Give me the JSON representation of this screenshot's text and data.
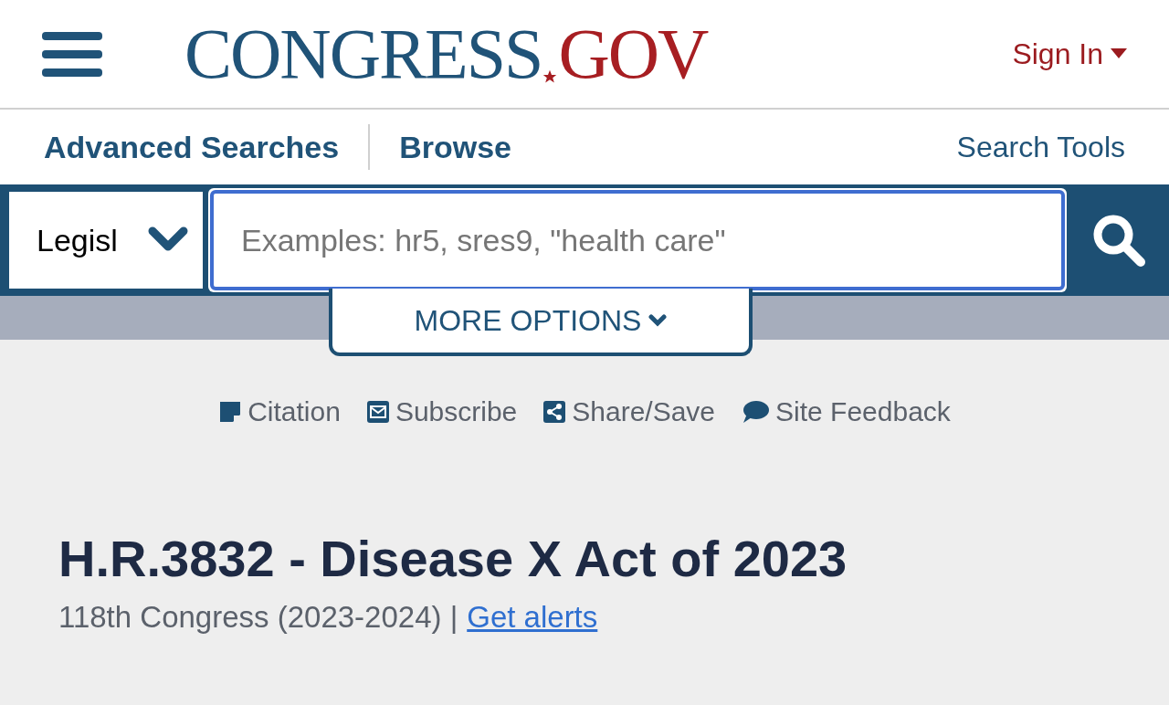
{
  "header": {
    "logo": {
      "first": "CONGRESS",
      "second": "GOV"
    },
    "sign_in": "Sign In"
  },
  "nav": {
    "items": [
      {
        "label": "Advanced Searches"
      },
      {
        "label": "Browse"
      }
    ],
    "tools": "Search Tools"
  },
  "search": {
    "scope": "Legisl",
    "placeholder": "Examples: hr5, sres9, \"health care\"",
    "more_options": "MORE OPTIONS"
  },
  "actions": [
    {
      "kind": "citation",
      "label": "Citation"
    },
    {
      "kind": "subscribe",
      "label": "Subscribe"
    },
    {
      "kind": "share",
      "label": "Share/Save"
    },
    {
      "kind": "feedback",
      "label": "Site Feedback"
    }
  ],
  "bill": {
    "title": "H.R.3832 - Disease X Act of 2023",
    "congress": "118th Congress (2023-2024) |",
    "alerts_link": "Get alerts"
  }
}
